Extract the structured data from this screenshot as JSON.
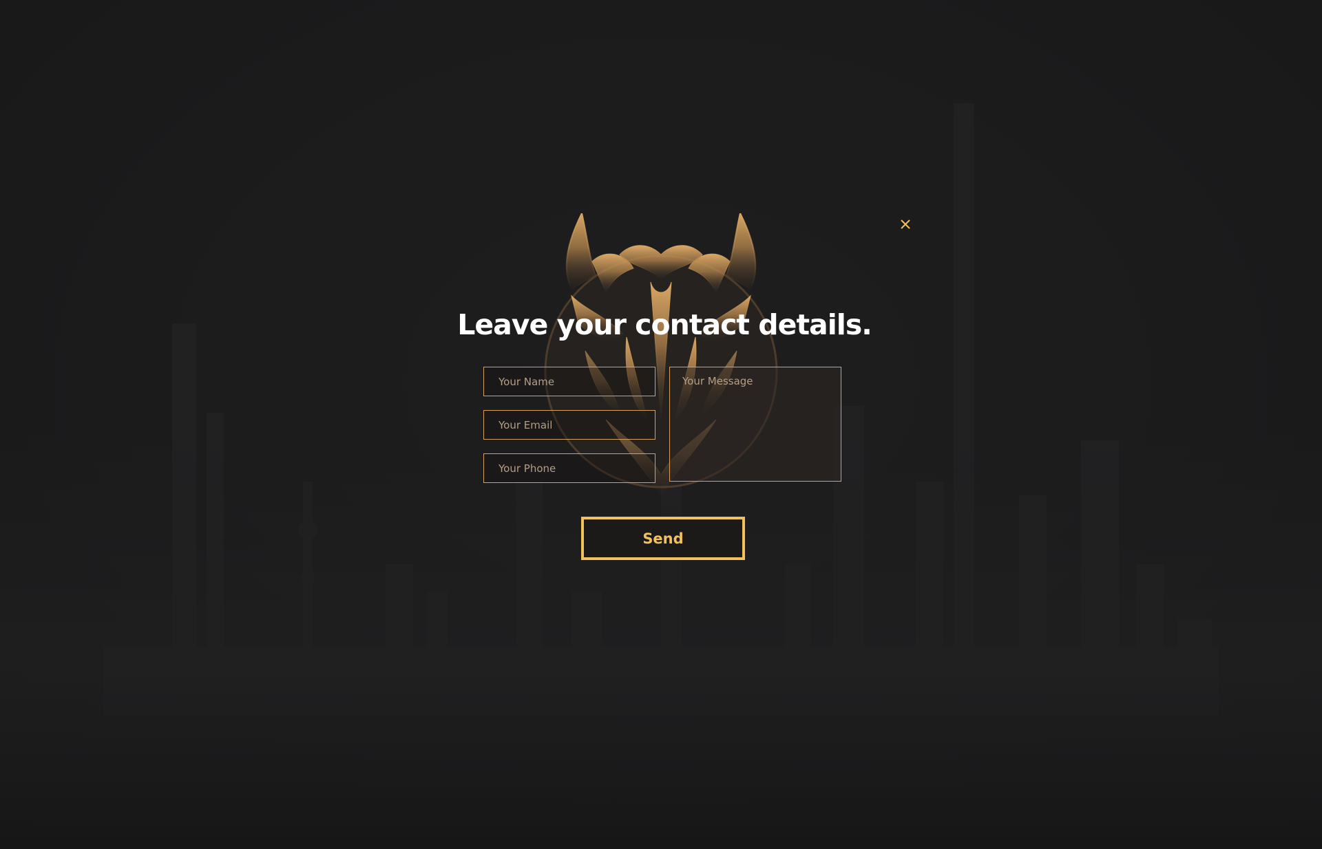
{
  "dialog": {
    "title": "Leave your contact details.",
    "close_icon": "close-icon",
    "emblem_icon": "tiger-head-emblem"
  },
  "form": {
    "name_placeholder": "Your Name",
    "email_placeholder": "Your Email",
    "phone_placeholder": "Your Phone",
    "message_placeholder": "Your Message",
    "send_label": "Send"
  },
  "colors": {
    "background": "#1b1b1c",
    "accent_gold": "#f3c05e",
    "field_border": "#d4a15f",
    "title": "#ffffff"
  }
}
